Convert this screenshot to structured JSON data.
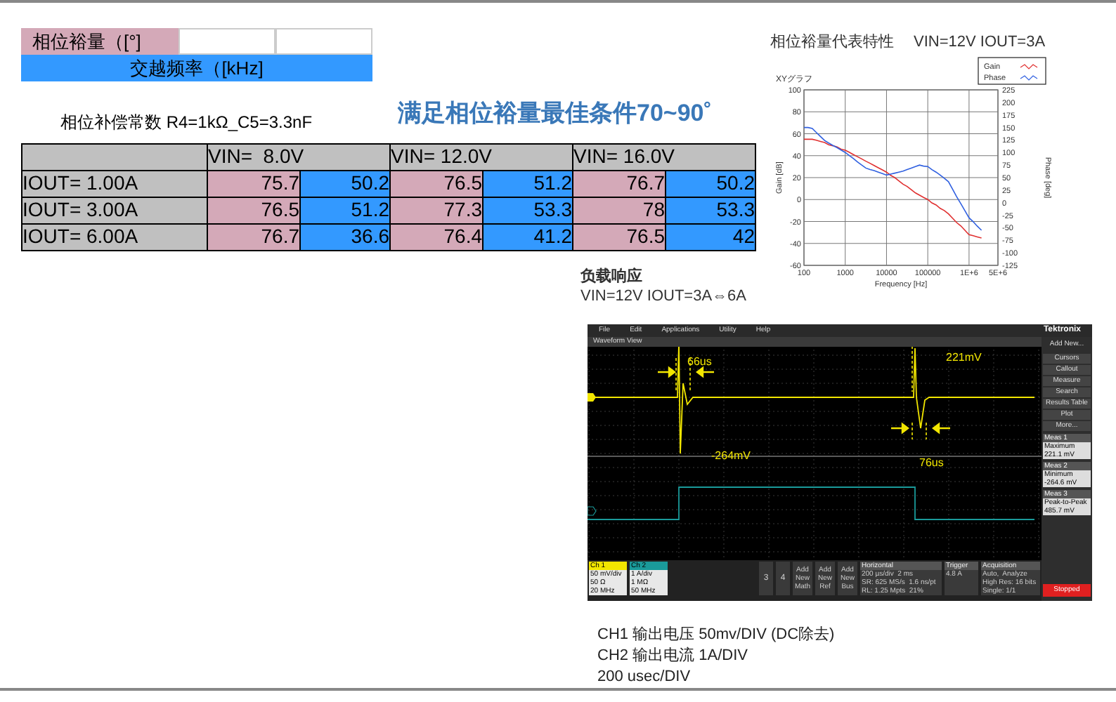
{
  "header_cells": {
    "phase_margin_label": "相位裕量（[°]",
    "crossover_label": "交越频率（[kHz]"
  },
  "compensation_note": "相位补偿常数 R4=1kΩ_C5=3.3nF",
  "headline": "满足相位裕量最佳条件70~90˚",
  "table": {
    "columns": [
      {
        "label": "VIN=  8.0V",
        "colspan": 2
      },
      {
        "label": "VIN= 12.0V",
        "colspan": 2
      },
      {
        "label": "VIN= 16.0V",
        "colspan": 2
      }
    ],
    "rows": [
      {
        "label": "IOUT= 1.00A",
        "cells": [
          {
            "kind": "phase",
            "value": "75.7"
          },
          {
            "kind": "crossover",
            "value": "50.2"
          },
          {
            "kind": "phase",
            "value": "76.5"
          },
          {
            "kind": "crossover",
            "value": "51.2"
          },
          {
            "kind": "phase",
            "value": "76.7"
          },
          {
            "kind": "crossover",
            "value": "50.2"
          }
        ]
      },
      {
        "label": "IOUT= 3.00A",
        "cells": [
          {
            "kind": "phase",
            "value": "76.5"
          },
          {
            "kind": "crossover",
            "value": "51.2"
          },
          {
            "kind": "phase",
            "value": "77.3"
          },
          {
            "kind": "crossover",
            "value": "53.3"
          },
          {
            "kind": "phase",
            "value": "78"
          },
          {
            "kind": "crossover",
            "value": "53.3"
          }
        ]
      },
      {
        "label": "IOUT= 6.00A",
        "cells": [
          {
            "kind": "phase",
            "value": "76.7"
          },
          {
            "kind": "crossover",
            "value": "36.6"
          },
          {
            "kind": "phase",
            "value": "76.4"
          },
          {
            "kind": "crossover",
            "value": "41.2"
          },
          {
            "kind": "phase",
            "value": "76.5"
          },
          {
            "kind": "crossover",
            "value": "42"
          }
        ]
      }
    ]
  },
  "bode": {
    "title": "相位裕量代表特性",
    "condition": "VIN=12V IOUT=3A",
    "graph_label": "XYグラフ",
    "gain": {
      "chart_data": {
        "type": "line",
        "xlabel": "Frequency [Hz]",
        "ylabel": "Gain [dB]",
        "grid": true,
        "categories": [
          "100",
          null,
          null,
          null,
          null,
          null,
          null,
          null,
          null,
          null,
          "1000",
          null,
          null,
          null,
          null,
          null,
          null,
          null,
          null,
          null,
          "10000",
          null,
          null,
          null,
          null,
          null,
          null,
          null,
          null,
          null,
          "100000",
          null,
          null,
          null,
          null,
          null,
          null,
          null,
          null,
          null,
          "1E+6",
          null,
          null,
          null,
          null,
          null,
          null,
          "5E+6"
        ],
        "series": [
          {
            "name": "Gain",
            "color": "#e03030",
            "values": [
              55,
              55,
              55,
              54,
              53,
              52,
              50,
              49,
              48,
              46,
              45,
              43,
              41,
              39,
              37,
              35,
              33,
              31,
              29,
              27,
              25,
              22,
              20,
              17,
              14,
              12,
              9,
              6,
              4,
              2,
              0,
              -3,
              -5,
              -8,
              -10,
              -13,
              -17,
              -21,
              -24,
              -28,
              -32,
              -33,
              -34,
              -35,
              null,
              null,
              null,
              null
            ]
          }
        ],
        "ylim": [
          -60,
          100
        ],
        "yticks": [
          -60,
          -40,
          -20,
          0,
          20,
          40,
          60,
          80,
          100
        ]
      }
    },
    "phase": {
      "chart_data": {
        "type": "line",
        "ylabel": "Phase [deg]",
        "categories": [
          null,
          null,
          null,
          null,
          null,
          null,
          null,
          null,
          null,
          null,
          null,
          null,
          null,
          null,
          null,
          null,
          null,
          null,
          null,
          null,
          null,
          null,
          null,
          null,
          null,
          null,
          null,
          null,
          null,
          null,
          null,
          null,
          null,
          null,
          null,
          null,
          null,
          null,
          null,
          null,
          null,
          null,
          null,
          null,
          null,
          null,
          null,
          null
        ],
        "series": [
          {
            "name": "Phase",
            "color": "#3060e0",
            "values": [
              150,
              150,
              148,
              140,
              132,
              124,
              119,
              114,
              110,
              105,
              100,
              94,
              88,
              81,
              75,
              69,
              66,
              64,
              61,
              58,
              55,
              57,
              59,
              61,
              63,
              66,
              69,
              72,
              75,
              73,
              72,
              66,
              61,
              55,
              49,
              42,
              27,
              12,
              -2,
              -16,
              -30,
              -38,
              -47,
              -55,
              null,
              null,
              null,
              null
            ]
          }
        ],
        "ylim": [
          -125,
          225
        ],
        "yticks": [
          -125,
          -100,
          -75,
          -50,
          -25,
          0,
          25,
          50,
          75,
          100,
          125,
          150,
          175,
          200,
          225
        ]
      }
    }
  },
  "load_response": {
    "title": "负载响应",
    "condition": "VIN=12V IOUT=3A⇔6A"
  },
  "scope": {
    "menu": [
      "File",
      "Edit",
      "Applications",
      "Utility",
      "Help"
    ],
    "brand": "Tektronix",
    "view_title": "Waveform View",
    "annotations": [
      {
        "kind": "width",
        "text": "66us"
      },
      {
        "kind": "level",
        "text": "221mV"
      },
      {
        "kind": "level_low",
        "text": "-264mV"
      },
      {
        "kind": "width_low",
        "text": "76us"
      }
    ],
    "side_panel": {
      "title": "Add New...",
      "buttons": [
        "Cursors",
        "Callout",
        "Measure",
        "Search",
        "Results Table",
        "Plot",
        "More..."
      ],
      "measurements": [
        {
          "title": "Meas 1",
          "name": "Maximum",
          "value": "221.1 mV"
        },
        {
          "title": "Meas 2",
          "name": "Minimum",
          "value": "-264.6 mV"
        },
        {
          "title": "Meas 3",
          "name": "Peak-to-Peak",
          "value": "485.7 mV"
        }
      ]
    },
    "channels": [
      {
        "name": "Ch 1",
        "lines": [
          "50 mV/div",
          "50 Ω",
          "20 MHz"
        ],
        "color": "#f2e600"
      },
      {
        "name": "Ch 2",
        "lines": [
          "1 A/div",
          "1 MΩ",
          "50 MHz"
        ],
        "color": "#1a9a9a"
      }
    ],
    "inactive_channels": [
      "3",
      "4"
    ],
    "add_buttons": [
      "Add New Math",
      "Add New Ref",
      "Add New Bus"
    ],
    "horizontal": {
      "title": "Horizontal",
      "lines": [
        "200 µs/div  2 ms",
        "SR: 625 MS/s  1.6 ns/pt",
        "RL: 1.25 Mpts  21%"
      ]
    },
    "trigger": {
      "title": "Trigger",
      "level": "4.8 A"
    },
    "acquisition": {
      "title": "Acquisition",
      "lines": [
        "Auto,  Analyze",
        "High Res: 16 bits",
        "Single: 1/1"
      ]
    },
    "run_state": "Stopped"
  },
  "captions": [
    "CH1 输出电压 50mv/DIV (DC除去)",
    "CH2 输出电流 1A/DIV",
    "200 usec/DIV"
  ]
}
